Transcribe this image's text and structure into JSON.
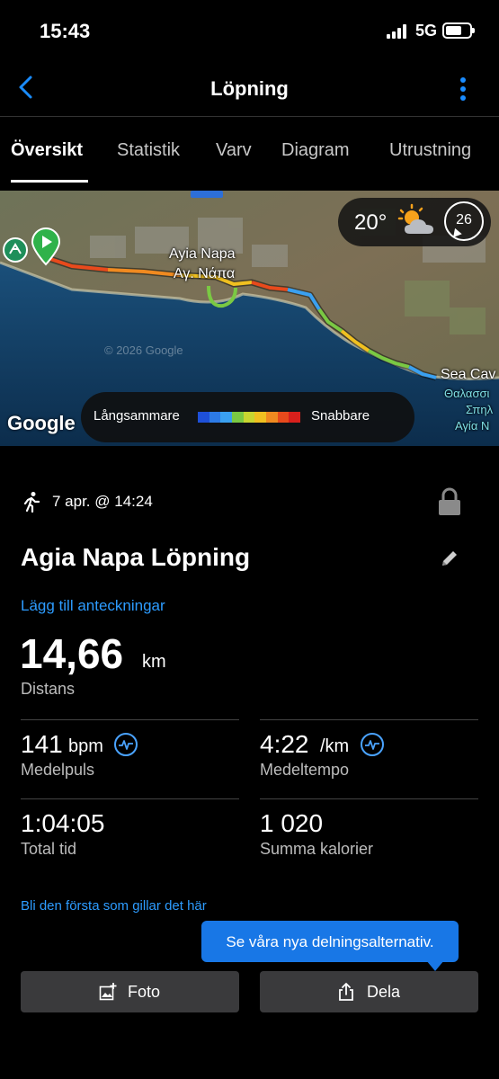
{
  "status_bar": {
    "time": "15:43",
    "network": "5G"
  },
  "nav": {
    "title": "Löpning"
  },
  "tabs": [
    {
      "label": "Översikt",
      "active": true
    },
    {
      "label": "Statistik",
      "active": false
    },
    {
      "label": "Varv",
      "active": false
    },
    {
      "label": "Diagram",
      "active": false
    },
    {
      "label": "Utrustning",
      "active": false
    }
  ],
  "map": {
    "place_name_latin": "Ayia Napa",
    "place_name_greek": "Αγ. Νάπα",
    "place_sea_caves": "Sea Cav",
    "place_sea_caves_greek_1": "Θαλασσι",
    "place_sea_caves_greek_2": "Σπηλ",
    "place_sea_caves_greek_3": "Αγία Ν",
    "watermark": "© 2026 Google",
    "google_logo": "Google",
    "weather_temp": "20°",
    "wind_speed": "26",
    "legend_slow": "Långsammare",
    "legend_fast": "Snabbare",
    "legend_colors": [
      "#1e50d8",
      "#2c7ae6",
      "#3aa0f0",
      "#7ac943",
      "#c8d630",
      "#f0c020",
      "#f08a20",
      "#e84a1c",
      "#d8201c"
    ]
  },
  "activity": {
    "date": "7 apr. @ 14:24",
    "title": "Agia Napa Löpning",
    "add_notes": "Lägg till anteckningar",
    "distance_value": "14,66",
    "distance_unit": "km",
    "distance_label": "Distans"
  },
  "stats": {
    "avg_hr_value": "141",
    "avg_hr_unit": "bpm",
    "avg_hr_label": "Medelpuls",
    "avg_pace_value": "4:22",
    "avg_pace_unit": "/km",
    "avg_pace_label": "Medeltempo",
    "total_time_value": "1:04:05",
    "total_time_label": "Total tid",
    "calories_value": "1 020",
    "calories_label": "Summa kalorier"
  },
  "social": {
    "like_text": "Bli den första som gillar det här"
  },
  "tooltip": {
    "text": "Se våra nya delningsalternativ."
  },
  "buttons": {
    "photo_label": "Foto",
    "share_label": "Dela"
  },
  "colors": {
    "accent": "#2d9cff",
    "tooltip_bg": "#1877e6",
    "button_bg": "#3a3a3c"
  }
}
